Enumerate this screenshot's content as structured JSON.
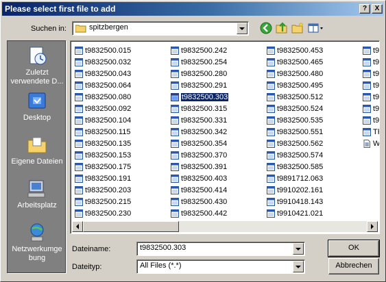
{
  "window": {
    "title": "Please select first file to add",
    "help_label": "?",
    "close_label": "X"
  },
  "toolbar": {
    "lookin_label": "Suchen in:",
    "lookin_value": "spitzbergen"
  },
  "places": [
    {
      "label": "Zuletzt verwendete D...",
      "icon": "recent-documents-icon"
    },
    {
      "label": "Desktop",
      "icon": "desktop-icon"
    },
    {
      "label": "Eigene Dateien",
      "icon": "my-documents-icon"
    },
    {
      "label": "Arbeitsplatz",
      "icon": "my-computer-icon"
    },
    {
      "label": "Netzwerkumge bung",
      "icon": "network-icon"
    }
  ],
  "files": {
    "col1": [
      "t9832500.015",
      "t9832500.032",
      "t9832500.043",
      "t9832500.064",
      "t9832500.080",
      "t9832500.092",
      "t9832500.104",
      "t9832500.115",
      "t9832500.135",
      "t9832500.153",
      "t9832500.175",
      "t9832500.191",
      "t9832500.203",
      "t9832500.215",
      "t9832500.230"
    ],
    "col2": [
      "t9832500.242",
      "t9832500.254",
      "t9832500.280",
      "t9832500.291",
      "t9832500.303",
      "t9832500.315",
      "t9832500.331",
      "t9832500.342",
      "t9832500.354",
      "t9832500.370",
      "t9832500.391",
      "t9832500.403",
      "t9832500.414",
      "t9832500.430",
      "t9832500.442"
    ],
    "col3": [
      "t9832500.453",
      "t9832500.465",
      "t9832500.480",
      "t9832500.495",
      "t9832500.512",
      "t9832500.524",
      "t9832500.535",
      "t9832500.551",
      "t9832500.562",
      "t9832500.574",
      "t9832500.585",
      "t9891712.063",
      "t9910202.161",
      "t9910418.143",
      "t9910421.021"
    ],
    "col4": [
      "t9",
      "t9",
      "t9",
      "t9",
      "t9",
      "t9",
      "t9",
      "TF",
      "W"
    ],
    "selected": "t9832500.303"
  },
  "bottom": {
    "filename_label": "Dateiname:",
    "filename_value": "t9832500.303",
    "filetype_label": "Dateityp:",
    "filetype_value": "All Files (*.*)",
    "ok_label": "OK",
    "cancel_label": "Abbrechen"
  },
  "colors": {
    "title_start": "#0a246a",
    "title_end": "#a6caf0",
    "selection": "#0a246a",
    "places_bg": "#808080",
    "dialog_bg": "#d4d0c8"
  }
}
